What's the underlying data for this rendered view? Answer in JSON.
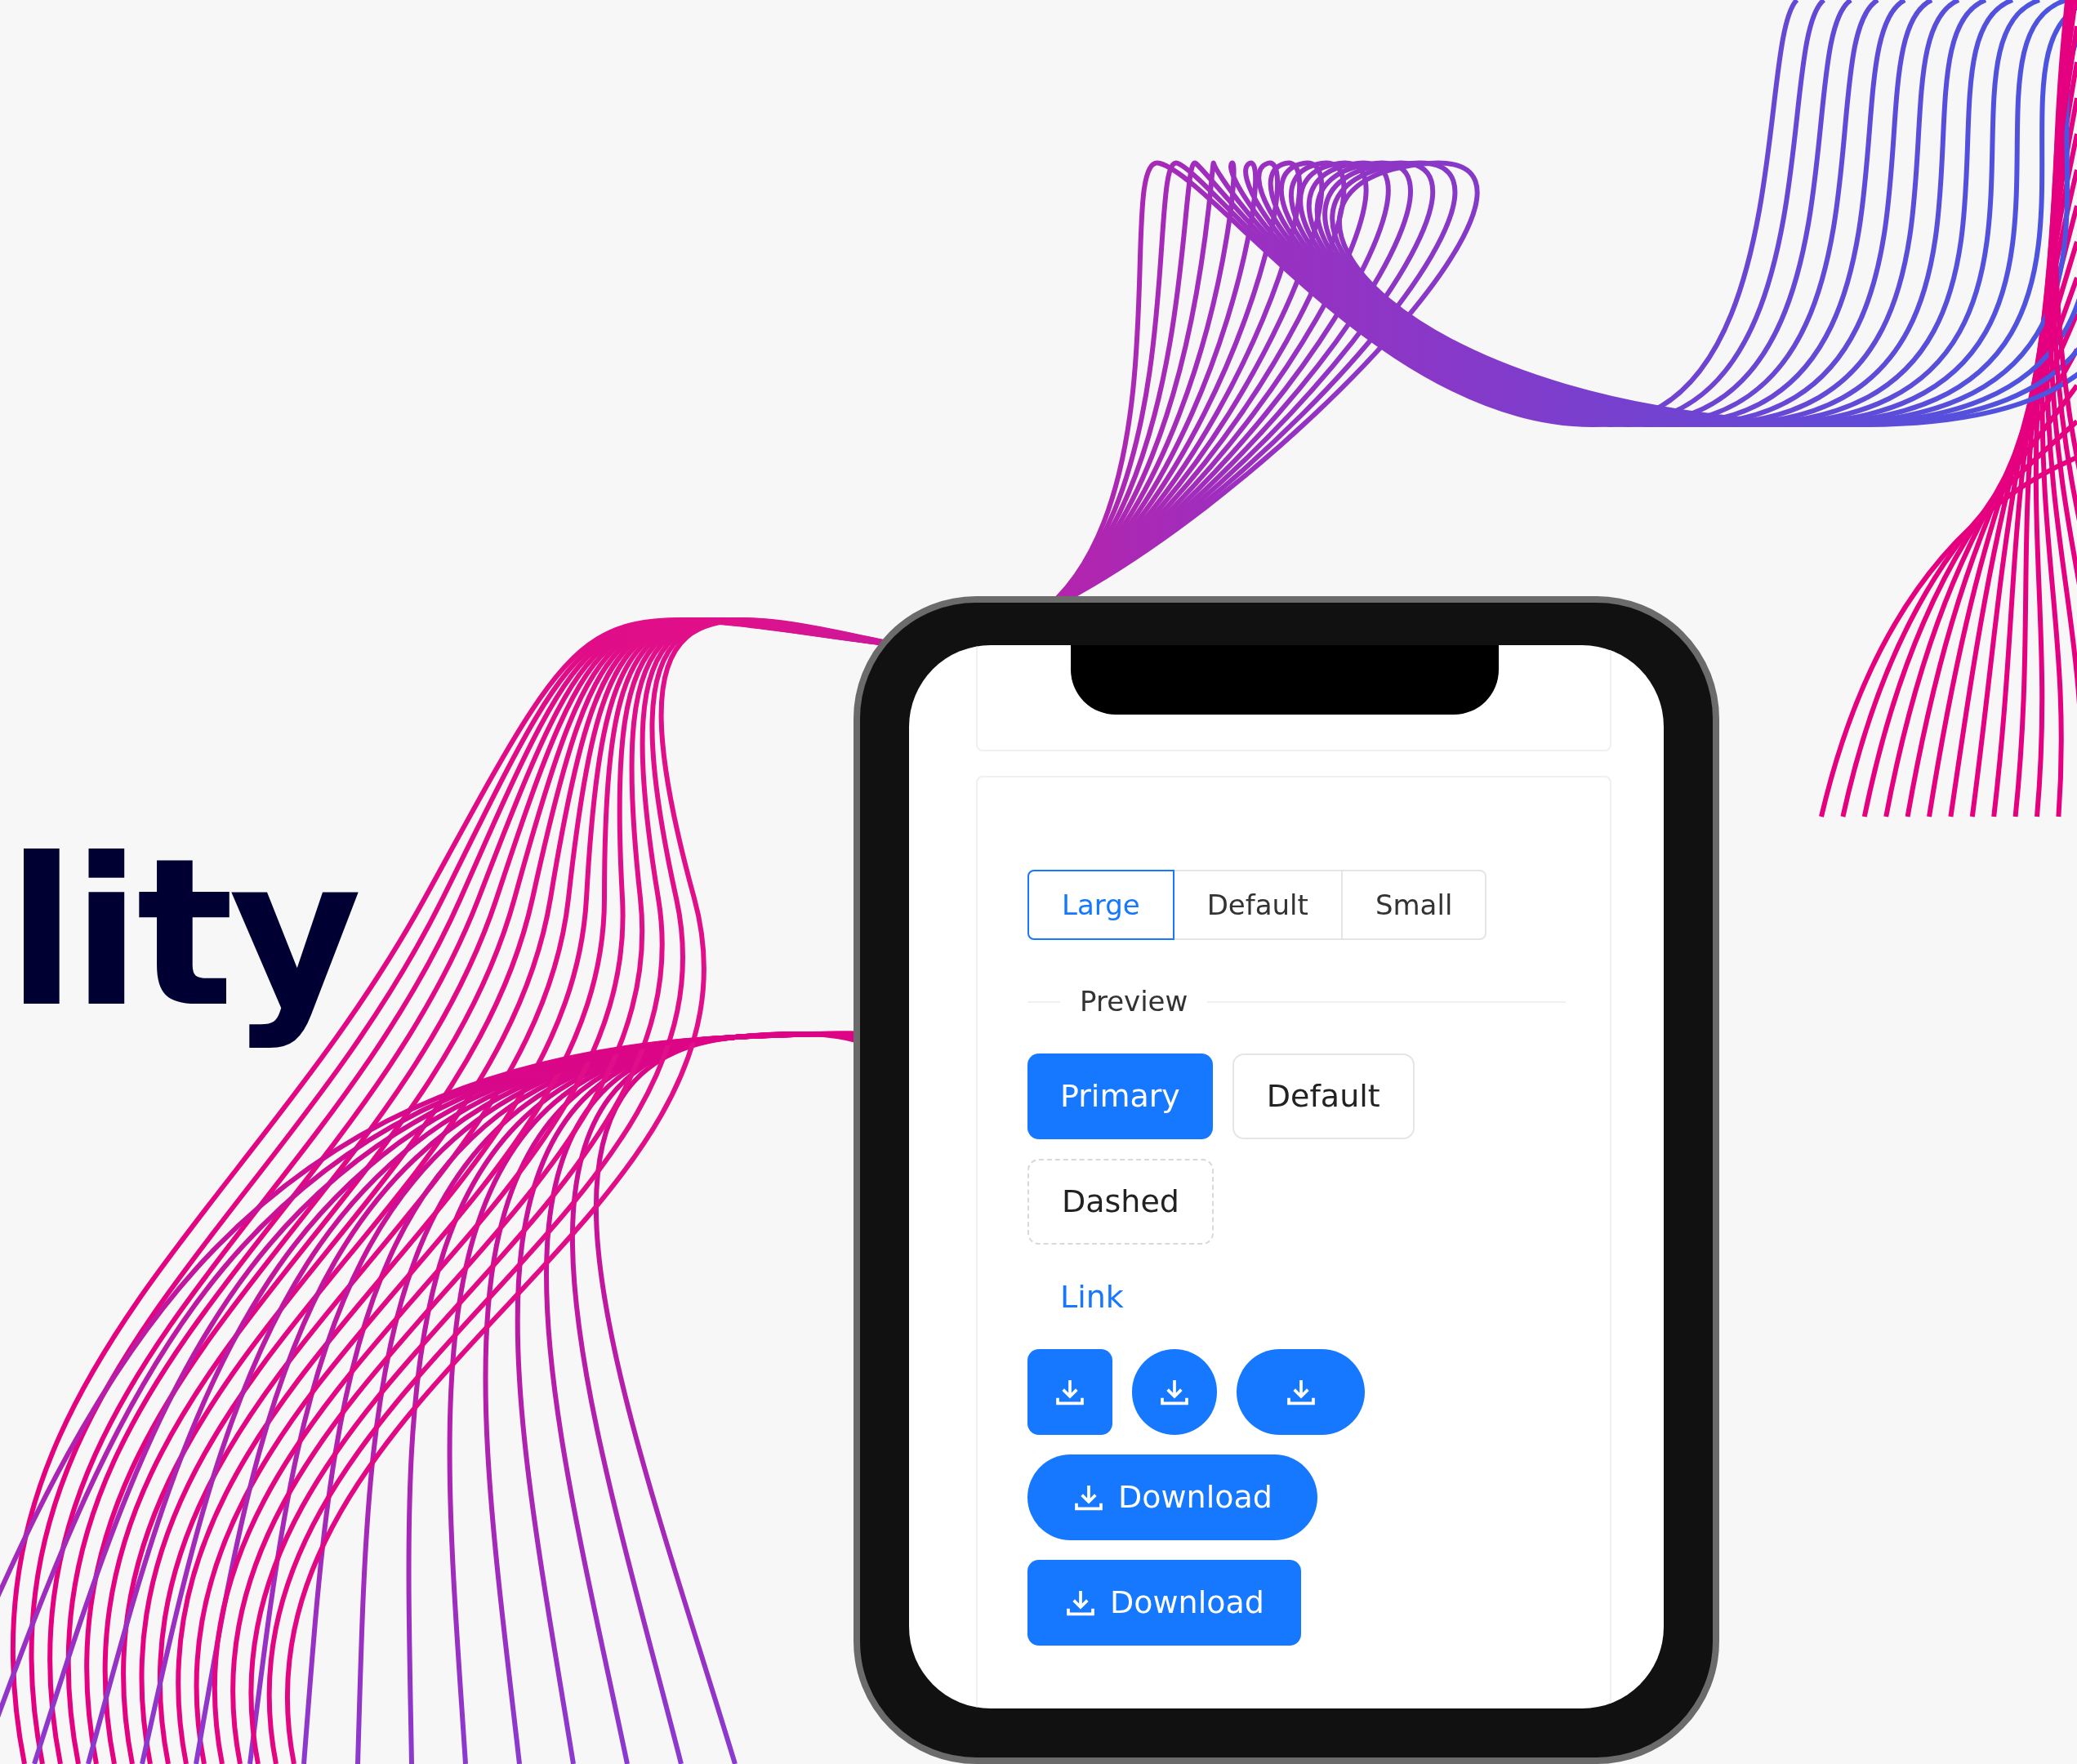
{
  "headline": "lity",
  "size_selector": [
    {
      "label": "Large",
      "selected": true
    },
    {
      "label": "Default",
      "selected": false
    },
    {
      "label": "Small",
      "selected": false
    }
  ],
  "section_title": "Preview",
  "button_rows": [
    [
      {
        "kind": "primary",
        "label": "Primary"
      },
      {
        "kind": "default",
        "label": "Default"
      }
    ],
    [
      {
        "kind": "dashed",
        "label": "Dashed"
      }
    ],
    [
      {
        "kind": "link",
        "label": "Link"
      }
    ],
    [
      {
        "kind": "icon-square"
      },
      {
        "kind": "icon-circle"
      },
      {
        "kind": "icon-pill"
      }
    ],
    [
      {
        "kind": "pill",
        "label": "Download"
      }
    ],
    [
      {
        "kind": "rect",
        "label": "Download"
      }
    ]
  ]
}
